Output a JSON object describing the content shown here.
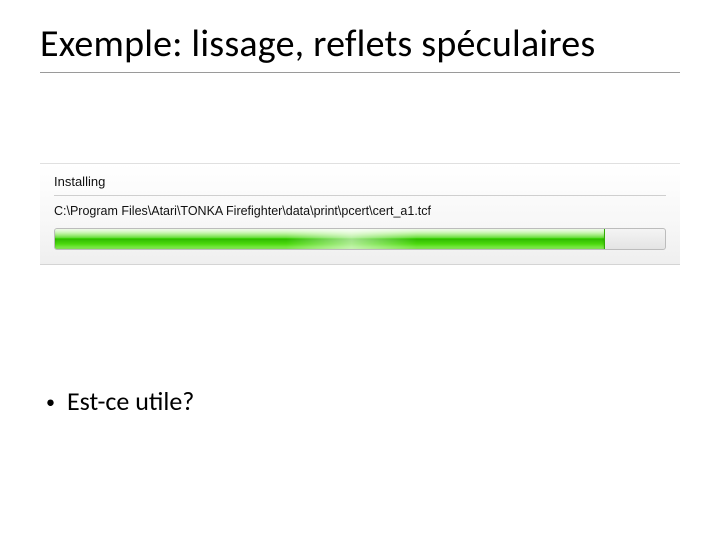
{
  "slide": {
    "title": "Exemple: lissage, reflets spéculaires",
    "bullet1": "Est-ce utile?"
  },
  "installer": {
    "heading": "Installing",
    "path": "C:\\Program Files\\Atari\\TONKA Firefighter\\data\\print\\pcert\\cert_a1.tcf",
    "progress_percent": 90,
    "bar_color": "#34cf00"
  }
}
